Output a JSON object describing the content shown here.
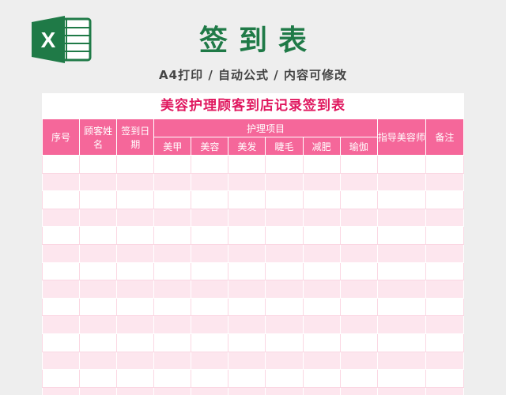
{
  "header": {
    "title": "签到表",
    "subtitle": "A4打印 / 自动公式 / 内容可修改",
    "logo_icon": "excel-icon",
    "logo_letter": "X",
    "logo_color": "#1f7a47"
  },
  "sheet": {
    "title": "美容护理顾客到店记录签到表",
    "title_color": "#e0185f",
    "header_color": "#f5679a",
    "stripe_color": "#fde6ee",
    "columns": {
      "seq": "序号",
      "name": "顾客姓名",
      "date": "签到日期",
      "group": "护理项目",
      "items": [
        "美甲",
        "美容",
        "美发",
        "睫毛",
        "减肥",
        "瑜伽"
      ],
      "beautician": "指导美容师",
      "note": "备注"
    },
    "row_count": 14
  }
}
